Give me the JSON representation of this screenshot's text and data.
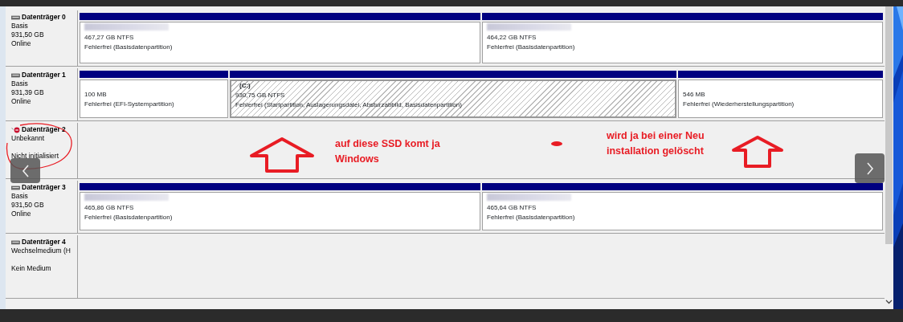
{
  "disks": [
    {
      "name": "Datenträger 0",
      "kind": "drive",
      "info_groups": [
        [
          "Basis",
          "931,50 GB",
          "Online"
        ]
      ],
      "partitions": [
        {
          "label_redacted": true,
          "size": "467,27 GB NTFS",
          "status": "Fehlerfrei (Basisdatenpartition)",
          "selected": false
        },
        {
          "label_redacted": true,
          "size": "464,22 GB NTFS",
          "status": "Fehlerfrei (Basisdatenpartition)",
          "selected": false
        }
      ]
    },
    {
      "name": "Datenträger 1",
      "kind": "drive",
      "info_groups": [
        [
          "Basis",
          "931,39 GB",
          "Online"
        ]
      ],
      "partitions": [
        {
          "label_redacted": false,
          "size": "100 MB",
          "status": "Fehlerfrei (EFI-Systempartition)",
          "selected": false
        },
        {
          "label_redacted": false,
          "label": "(C:)",
          "size": "930,75 GB NTFS",
          "status": "Fehlerfrei (Startpartition, Auslagerungsdatei, Absturzabbild, Basisdatenpartition)",
          "selected": true
        },
        {
          "label_redacted": false,
          "size": "546 MB",
          "status": "Fehlerfrei (Wiederherstellungspartition)",
          "selected": false
        }
      ]
    },
    {
      "name": "Datenträger 2",
      "kind": "error",
      "info_groups": [
        [
          "Unbekannt"
        ],
        [
          "Nicht initialisiert"
        ]
      ]
    },
    {
      "name": "Datenträger 3",
      "kind": "drive",
      "info_groups": [
        [
          "Basis",
          "931,50 GB",
          "Online"
        ]
      ],
      "partitions": [
        {
          "label_redacted": true,
          "size": "465,86 GB NTFS",
          "status": "Fehlerfrei (Basisdatenpartition)",
          "selected": false
        },
        {
          "label_redacted": true,
          "size": "465,64 GB NTFS",
          "status": "Fehlerfrei (Basisdatenpartition)",
          "selected": false
        }
      ]
    },
    {
      "name": "Datenträger 4",
      "kind": "drive",
      "info_groups": [
        [
          "Wechselmedium (H"
        ],
        [
          "Kein Medium"
        ]
      ]
    }
  ],
  "annotations": [
    {
      "kind": "circle"
    },
    {
      "kind": "arrow"
    },
    {
      "kind": "text",
      "text": "auf diese SSD komt ja Windows"
    },
    {
      "kind": "dot"
    },
    {
      "kind": "text",
      "text": "wird ja bei einer Neu installation gelöscht"
    },
    {
      "kind": "arrow"
    }
  ]
}
